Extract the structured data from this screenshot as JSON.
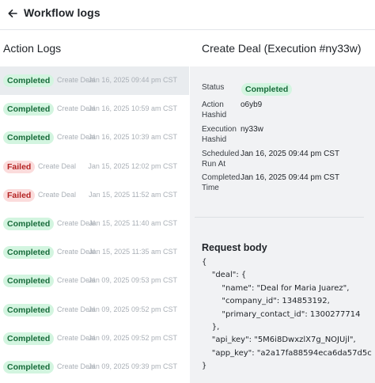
{
  "header": {
    "title": "Workflow logs",
    "back_icon": "arrow-left-icon"
  },
  "left_panel": {
    "heading": "Action Logs"
  },
  "logs": [
    {
      "status": "Completed",
      "status_kind": "completed",
      "action": "Create Deal",
      "time": "Jan 16, 2025 09:44 pm CST",
      "selected": true
    },
    {
      "status": "Completed",
      "status_kind": "completed",
      "action": "Create Deal",
      "time": "Jan 16, 2025 10:59 am CST",
      "selected": false
    },
    {
      "status": "Completed",
      "status_kind": "completed",
      "action": "Create Deal",
      "time": "Jan 16, 2025 10:39 am CST",
      "selected": false
    },
    {
      "status": "Failed",
      "status_kind": "failed",
      "action": "Create Deal",
      "time": "Jan 15, 2025 12:02 pm CST",
      "selected": false
    },
    {
      "status": "Failed",
      "status_kind": "failed",
      "action": "Create Deal",
      "time": "Jan 15, 2025 11:52 am CST",
      "selected": false
    },
    {
      "status": "Completed",
      "status_kind": "completed",
      "action": "Create Deal",
      "time": "Jan 15, 2025 11:40 am CST",
      "selected": false
    },
    {
      "status": "Completed",
      "status_kind": "completed",
      "action": "Create Deal",
      "time": "Jan 15, 2025 11:35 am CST",
      "selected": false
    },
    {
      "status": "Completed",
      "status_kind": "completed",
      "action": "Create Deal",
      "time": "Jan 09, 2025 09:53 pm CST",
      "selected": false
    },
    {
      "status": "Completed",
      "status_kind": "completed",
      "action": "Create Deal",
      "time": "Jan 09, 2025 09:52 pm CST",
      "selected": false
    },
    {
      "status": "Completed",
      "status_kind": "completed",
      "action": "Create Deal",
      "time": "Jan 09, 2025 09:52 pm CST",
      "selected": false
    },
    {
      "status": "Completed",
      "status_kind": "completed",
      "action": "Create Deal",
      "time": "Jan 09, 2025 09:39 pm CST",
      "selected": false
    }
  ],
  "detail": {
    "heading": "Create Deal (Execution #ny33w)",
    "status_label": "Status",
    "status_value": "Completed",
    "action_hashid_label": "Action Hashid",
    "action_hashid_value": "o6yb9",
    "execution_hashid_label": "Execution Hashid",
    "execution_hashid_value": "ny33w",
    "scheduled_label": "Scheduled Run At",
    "scheduled_value": "Jan 16, 2025 09:44 pm CST",
    "completed_label": "Completed Time",
    "completed_value": "Jan 16, 2025 09:44 pm CST"
  },
  "request_body": {
    "title": "Request body",
    "lines": [
      "{",
      "    \"deal\": {",
      "        \"name\": \"Deal for Maria Juarez\",",
      "        \"company_id\": 134853192,",
      "        \"primary_contact_id\": 1300277714",
      "    },",
      "    \"api_key\": \"5M6i8DwxzlX7g_NOJUjl\",",
      "    \"app_key\": \"a2a17fa88594eca6da57d5c",
      "}"
    ]
  },
  "colors": {
    "completed_bg": "#d3f5e0",
    "completed_text": "#176b3a",
    "failed_bg": "#fbdcdc",
    "failed_text": "#b42323",
    "selected_row": "#e9ecef",
    "detail_panel_bg": "#f1f2f4"
  }
}
